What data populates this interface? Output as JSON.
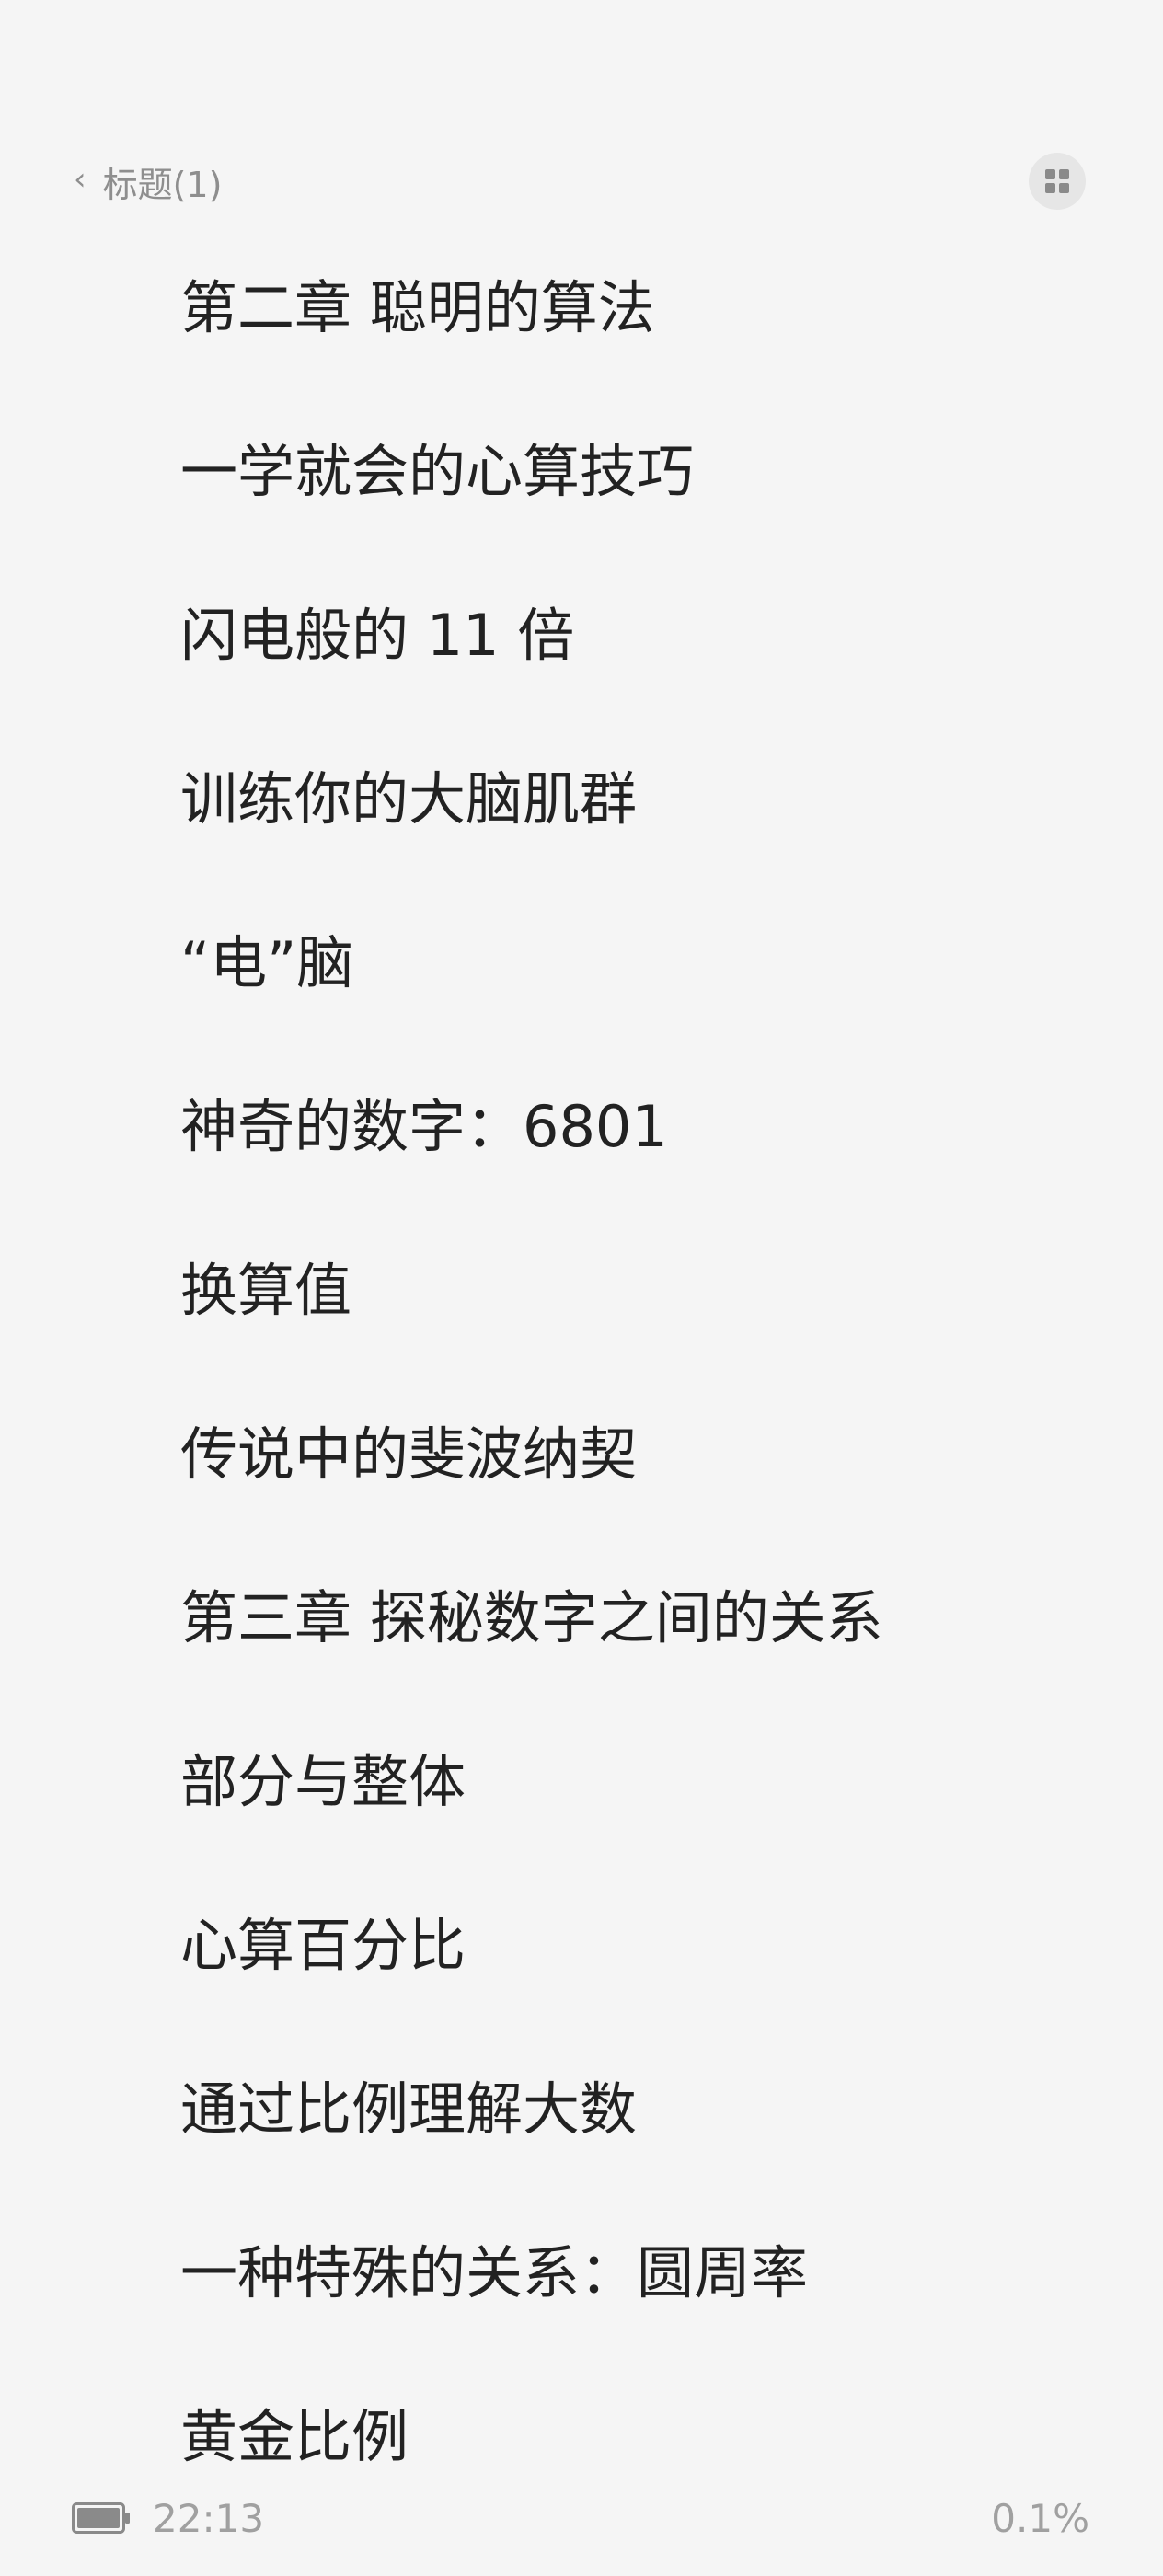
{
  "header": {
    "back_label": "标题(1)",
    "back_icon": "chevron-left-icon",
    "grid_icon": "grid-view-icon"
  },
  "toc": {
    "items": [
      "第二章 聪明的算法",
      "一学就会的心算技巧",
      "闪电般的 11 倍",
      "训练你的大脑肌群",
      "“电”脑",
      "神奇的数字：6801",
      "换算值",
      "传说中的斐波纳契",
      "第三章 探秘数字之间的关系",
      "部分与整体",
      "心算百分比",
      "通过比例理解大数",
      "一种特殊的关系：圆周率",
      "黄金比例"
    ]
  },
  "status": {
    "battery_icon": "battery-icon",
    "time": "22:13",
    "progress": "0.1%"
  },
  "colors": {
    "background": "#f5f5f5",
    "text": "#222222",
    "muted": "#a0a0a0",
    "button_bg": "#e6e6e6"
  }
}
